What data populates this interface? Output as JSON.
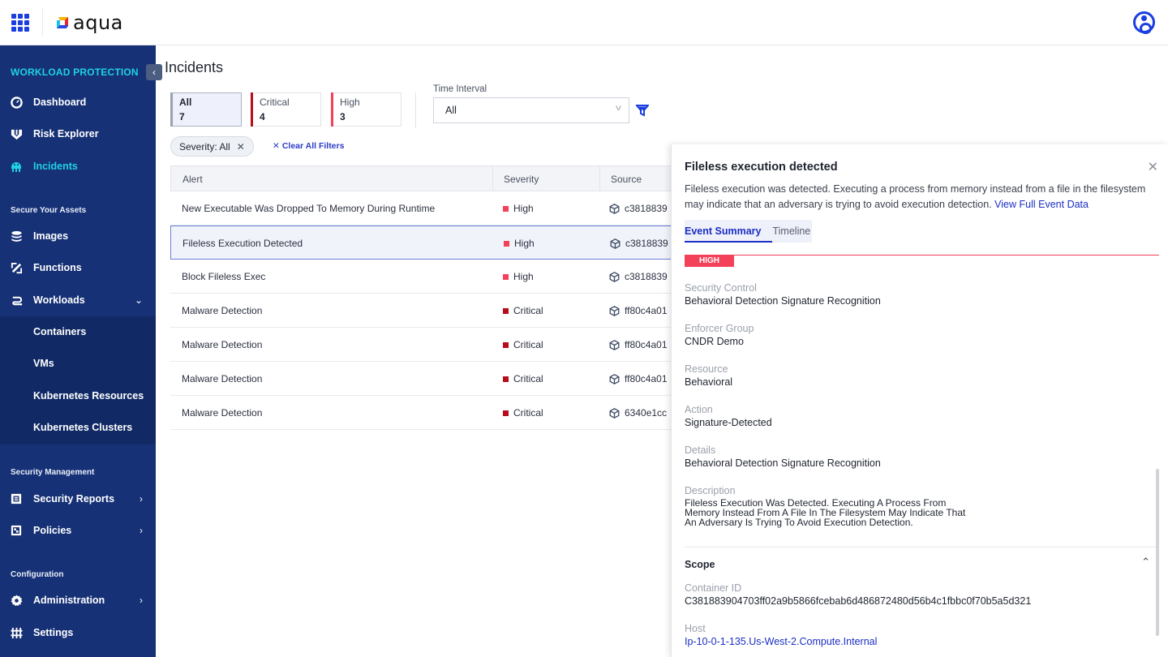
{
  "topbar": {
    "brand": "aqua",
    "apps_icon": "grid-icon",
    "user_icon": "user-icon"
  },
  "sidebar": {
    "header": "WORKLOAD PROTECTION",
    "collapse_icon": "‹",
    "items_top": [
      {
        "label": "Dashboard",
        "icon": "dashboard-icon"
      },
      {
        "label": "Risk Explorer",
        "icon": "risk-explorer-icon"
      },
      {
        "label": "Incidents",
        "icon": "incidents-icon",
        "active": true
      }
    ],
    "section_assets": "Secure Your Assets",
    "items_assets": [
      {
        "label": "Images",
        "icon": "images-icon"
      },
      {
        "label": "Functions",
        "icon": "functions-icon"
      },
      {
        "label": "Workloads",
        "icon": "workloads-icon",
        "chevron": "⌄"
      }
    ],
    "workloads_sub": [
      "Containers",
      "VMs",
      "Kubernetes Resources",
      "Kubernetes Clusters"
    ],
    "section_security": "Security Management",
    "items_security": [
      {
        "label": "Security Reports",
        "icon": "report-icon",
        "chevron": "›"
      },
      {
        "label": "Policies",
        "icon": "policies-icon",
        "chevron": "›"
      }
    ],
    "section_config": "Configuration",
    "items_config": [
      {
        "label": "Administration",
        "icon": "gear-icon",
        "chevron": "›"
      },
      {
        "label": "Settings",
        "icon": "settings-icon"
      }
    ]
  },
  "main": {
    "title": "Incidents",
    "severity_cards": [
      {
        "label": "All",
        "count": "7",
        "selected": true
      },
      {
        "label": "Critical",
        "count": "4"
      },
      {
        "label": "High",
        "count": "3"
      }
    ],
    "time_interval": {
      "label": "Time Interval",
      "value": "All"
    },
    "chip": {
      "label": "Severity: All",
      "close": "✕"
    },
    "clear_all": "Clear All Filters",
    "clear_icon": "✕",
    "table": {
      "headers": [
        "Alert",
        "Severity",
        "Source"
      ],
      "rows": [
        {
          "alert": "New Executable Was Dropped To Memory During Runtime",
          "severity": "High",
          "source": "c3818839"
        },
        {
          "alert": "Fileless Execution Detected",
          "severity": "High",
          "source": "c3818839",
          "selected": true
        },
        {
          "alert": "Block Fileless Exec",
          "severity": "High",
          "source": "c3818839"
        },
        {
          "alert": "Malware Detection",
          "severity": "Critical",
          "source": "ff80c4a01"
        },
        {
          "alert": "Malware Detection",
          "severity": "Critical",
          "source": "ff80c4a01"
        },
        {
          "alert": "Malware Detection",
          "severity": "Critical",
          "source": "ff80c4a01"
        },
        {
          "alert": "Malware Detection",
          "severity": "Critical",
          "source": "6340e1cc"
        }
      ]
    }
  },
  "colors": {
    "high": "#f4415a",
    "critical": "#b80c1a",
    "accent": "#1a2fc4",
    "sidebar_bg": "#163176",
    "sidebar_active": "#1fd0e6"
  },
  "panel": {
    "title": "Fileless execution detected",
    "close": "✕",
    "description": "Fileless execution was detected. Executing a process from memory instead from a file in the filesystem may indicate that an adversary is trying to avoid execution detection.",
    "view_link": "View Full Event Data",
    "tabs": [
      "Event Summary",
      "Timeline"
    ],
    "severity_badge": "HIGH",
    "fields": [
      {
        "label": "Security Control",
        "value": "Behavioral Detection Signature Recognition"
      },
      {
        "label": "Enforcer Group",
        "value": "CNDR Demo"
      },
      {
        "label": "Resource",
        "value": "Behavioral"
      },
      {
        "label": "Action",
        "value": "Signature-Detected"
      },
      {
        "label": "Details",
        "value": "Behavioral Detection Signature Recognition"
      },
      {
        "label": "Description",
        "value": "Fileless Execution Was Detected. Executing A Process From Memory Instead From A File In The Filesystem May Indicate That An Adversary Is Trying To Avoid Execution Detection."
      }
    ],
    "scope": {
      "title": "Scope",
      "chevron": "⌃",
      "fields": [
        {
          "label": "Container ID",
          "value": "C381883904703ff02a9b5866fcebab6d486872480d56b4c1fbbc0f70b5a5d321"
        },
        {
          "label": "Host",
          "value": "Ip-10-0-1-135.Us-West-2.Compute.Internal"
        }
      ]
    }
  }
}
